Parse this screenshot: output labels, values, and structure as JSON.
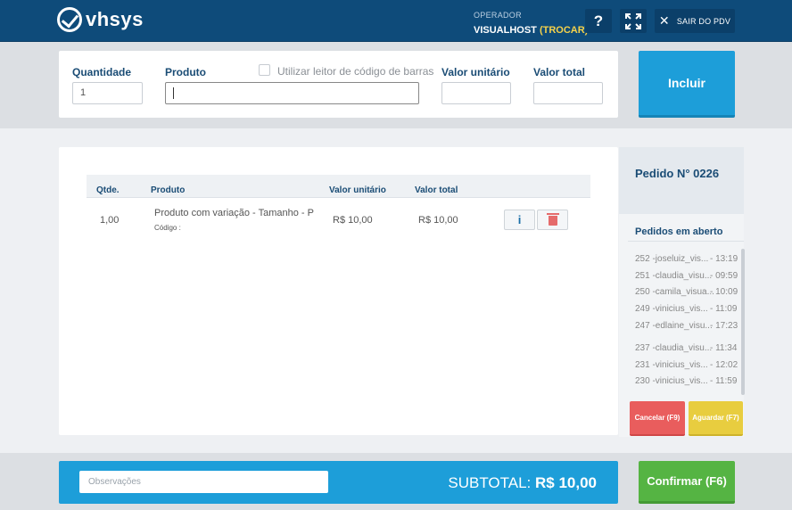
{
  "header": {
    "logo_text": "vhsys",
    "operator_label": "OPERADOR",
    "operator_name": "VISUALHOST",
    "operator_switch": "(TROCAR)",
    "help_label": "?",
    "exit_label": "SAIR DO PDV"
  },
  "entry": {
    "quantity_label": "Quantidade",
    "quantity_value": "1",
    "product_label": "Produto",
    "barcode_label": "Utilizar leitor de código de barras",
    "unit_value_label": "Valor unitário",
    "total_value_label": "Valor total",
    "include_button": "Incluir"
  },
  "table": {
    "headers": [
      "Qtde.",
      "Produto",
      "Valor unitário",
      "Valor total"
    ],
    "rows": [
      {
        "qty": "1,00",
        "product": "Produto com variação - Tamanho - P",
        "code": "Código :",
        "unit": "R$ 10,00",
        "total": "R$ 10,00",
        "info": "i"
      }
    ]
  },
  "sidebar": {
    "order_title": "Pedido N° 0226",
    "open_orders_title": "Pedidos em aberto",
    "open_orders": [
      {
        "name": "252 -joseluiz_vis...",
        "time": "- 13:19"
      },
      {
        "name": "251 -claudia_visu...",
        "time": "- 09:59"
      },
      {
        "name": "250 -camila_visua...",
        "time": "- 10:09"
      },
      {
        "name": "249 -vinicius_vis...",
        "time": "- 11:09"
      },
      {
        "name": "247 -edlaine_visu...",
        "time": "- 17:23"
      },
      {
        "name": "237 -claudia_visu...",
        "time": "- 11:34"
      },
      {
        "name": "231 -vinicius_vis...",
        "time": "- 12:02"
      },
      {
        "name": "230 -vinicius_vis...",
        "time": "- 11:59"
      }
    ],
    "cancel_button": "Cancelar (F9)",
    "wait_button": "Aguardar (F7)"
  },
  "footer": {
    "observations_placeholder": "Observações",
    "subtotal_label": "SUBTOTAL:",
    "subtotal_value": "R$ 10,00",
    "confirm_button": "Confirmar (F6)"
  },
  "colors": {
    "header_bg": "#0e4b7a",
    "accent_blue": "#1d9ed9",
    "confirm_green": "#55b443",
    "cancel_red": "#e95d5d",
    "wait_yellow": "#e8cd3f"
  }
}
